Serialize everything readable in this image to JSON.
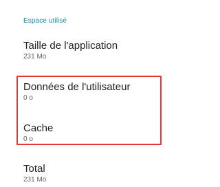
{
  "storage": {
    "section_header": "Espace utilisé",
    "items": [
      {
        "title": "Taille de l'application",
        "summary": "231 Mo"
      },
      {
        "title": "Données de l'utilisateur",
        "summary": "0 o"
      },
      {
        "title": "Cache",
        "summary": "0 o"
      },
      {
        "title": "Total",
        "summary": "231 Mo"
      }
    ]
  },
  "colors": {
    "accent": "#1e88a8",
    "highlight": "#e53935"
  }
}
